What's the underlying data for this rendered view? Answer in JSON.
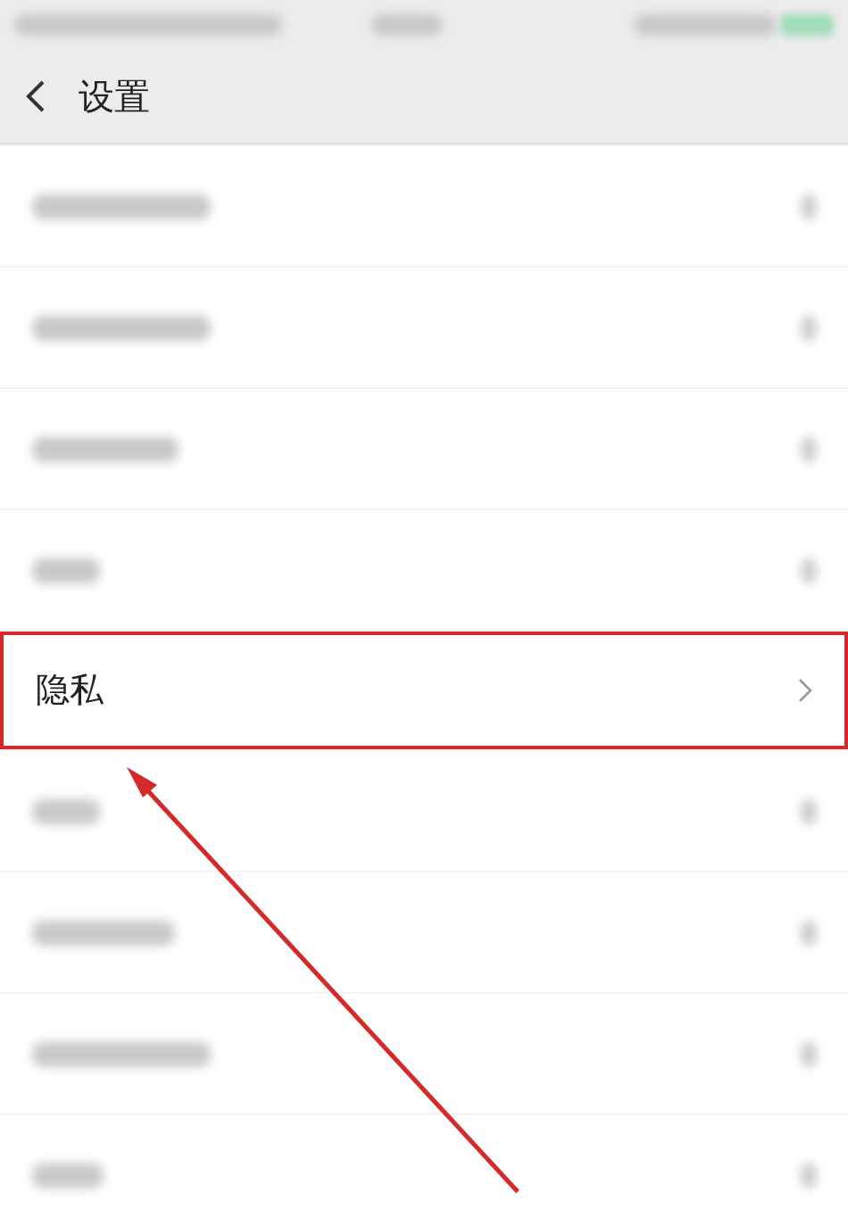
{
  "header": {
    "title": "设置"
  },
  "rows": [
    {
      "kind": "blurred",
      "highlighted": false
    },
    {
      "kind": "blurred",
      "highlighted": false
    },
    {
      "kind": "blurred",
      "highlighted": false
    },
    {
      "kind": "blurred",
      "highlighted": false
    },
    {
      "kind": "text",
      "label": "隐私",
      "highlighted": true
    },
    {
      "kind": "blurred",
      "highlighted": false
    },
    {
      "kind": "blurred",
      "highlighted": false
    },
    {
      "kind": "blurred",
      "highlighted": false
    },
    {
      "kind": "blurred",
      "highlighted": false
    }
  ],
  "annotation": {
    "kind": "arrow"
  }
}
